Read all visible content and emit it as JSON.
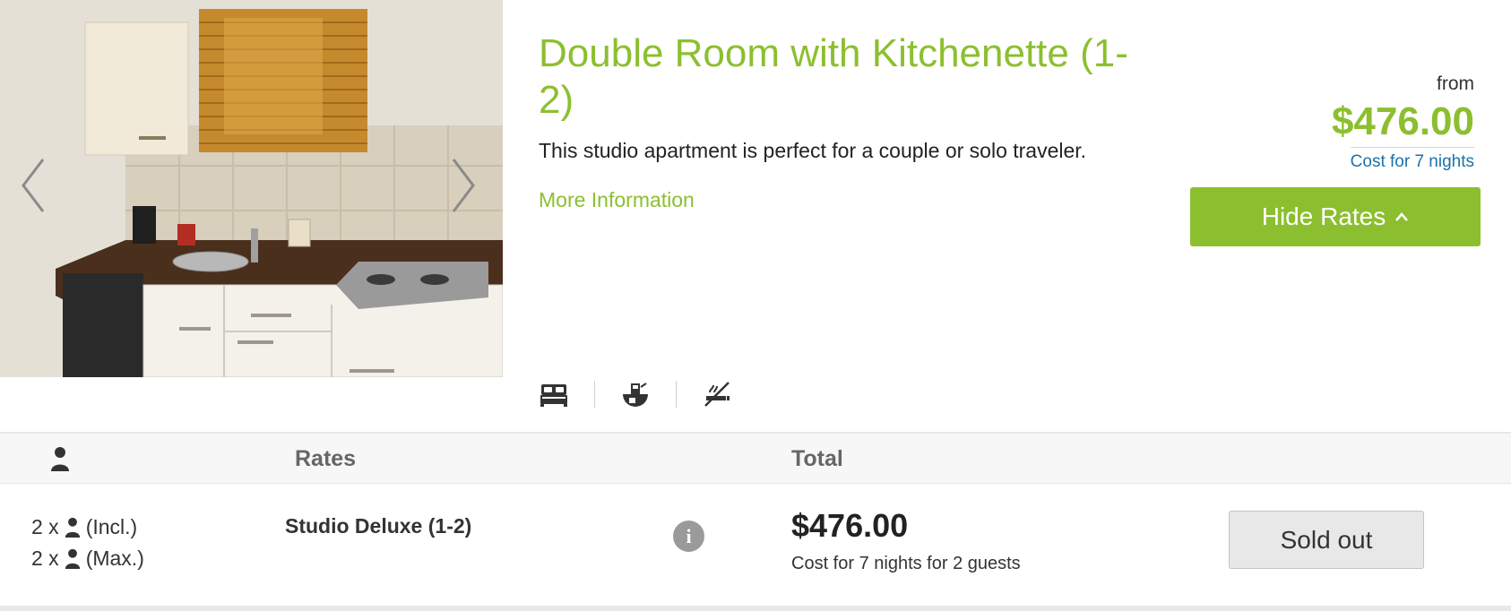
{
  "room": {
    "title": "Double Room with Kitchenette (1-2)",
    "description": "This studio apartment is perfect for a couple or solo traveler.",
    "more_info_label": "More Information",
    "photo_icon": "kitchenette-photo",
    "carousel": {
      "prev_icon": "chevron-left-icon",
      "next_icon": "chevron-right-icon"
    }
  },
  "pricing": {
    "from_label": "from",
    "amount": "$476.00",
    "note": "Cost for 7 nights",
    "hide_rates_label": "Hide Rates",
    "hide_rates_icon": "chevron-up-icon"
  },
  "amenities": [
    "bed-icon",
    "coffee-maker-icon",
    "no-smoking-icon"
  ],
  "rates_table": {
    "headers": {
      "occupancy_icon": "person-icon",
      "rates": "Rates",
      "total": "Total"
    },
    "rows": [
      {
        "occupancy_included": {
          "prefix": "2 x",
          "suffix": "(Incl.)"
        },
        "occupancy_max": {
          "prefix": "2 x",
          "suffix": "(Max.)"
        },
        "rate_name": "Studio Deluxe (1-2)",
        "info_icon": "info-icon",
        "total": "$476.00",
        "total_note": "Cost for 7 nights for 2 guests",
        "action_label": "Sold out"
      }
    ]
  },
  "colors": {
    "accent_green": "#8cbf2f",
    "link_blue": "#1a73a8",
    "header_bg": "#f7f7f7",
    "sold_out_bg": "#e8e8e8"
  }
}
